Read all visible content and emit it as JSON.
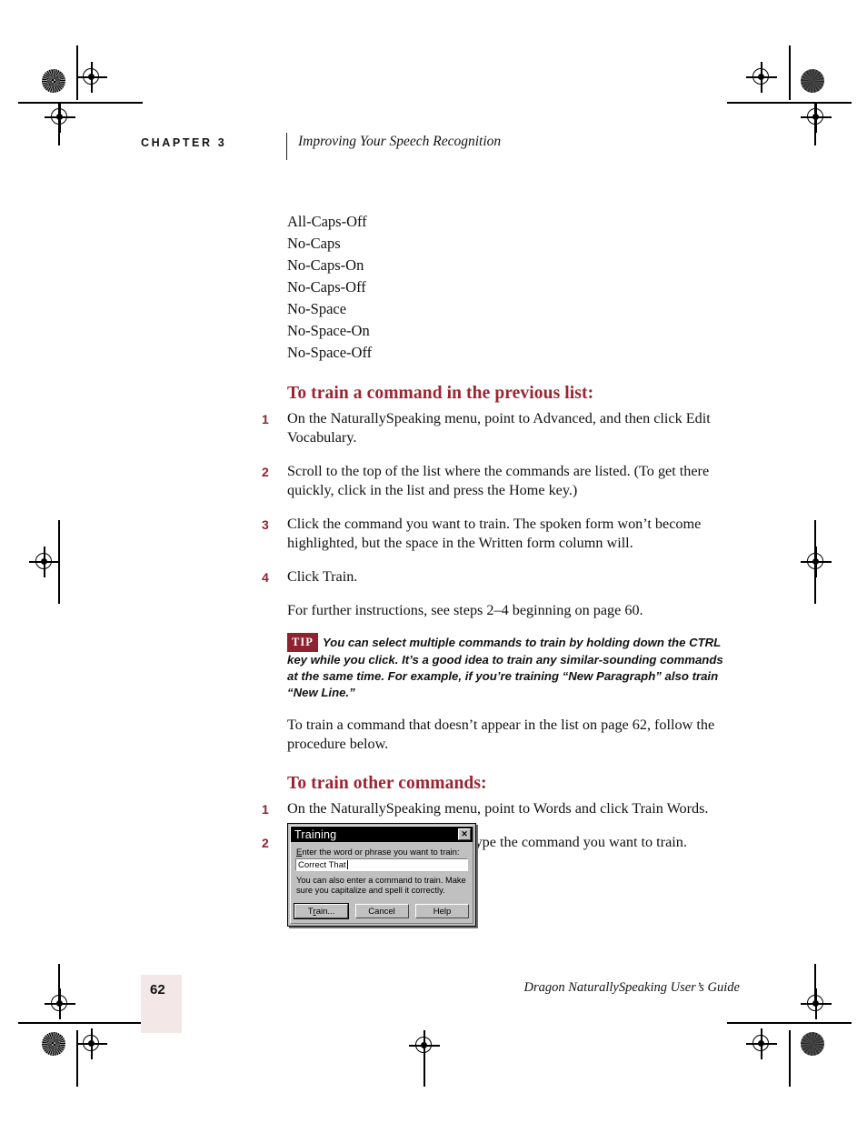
{
  "header": {
    "chapter_label": "CHAPTER 3",
    "chapter_title": "Improving Your Speech Recognition"
  },
  "command_list": [
    "All-Caps-Off",
    "No-Caps",
    "No-Caps-On",
    "No-Caps-Off",
    "No-Space",
    "No-Space-On",
    "No-Space-Off"
  ],
  "section_one": {
    "heading": "To train a command in the previous list:",
    "steps": [
      {
        "num": "1",
        "text": "On the NaturallySpeaking menu, point to Advanced, and then click Edit Vocabulary."
      },
      {
        "num": "2",
        "text": "Scroll to the top of the list where the commands are listed. (To get there quickly, click in the list and press the Home key.)"
      },
      {
        "num": "3",
        "text": "Click the command you want to train. The spoken form won’t become highlighted, but the space in the Written form column will."
      },
      {
        "num": "4",
        "text": "Click Train."
      }
    ],
    "follow_up": "For further instructions, see steps 2–4 beginning on page 60."
  },
  "tip": {
    "badge": "TIP",
    "text": "You can select multiple commands to train by holding down the CTRL key while you click. It’s a good idea to train any similar-sounding commands at the same time. For example, if you’re training “New Paragraph” also train “New Line.”"
  },
  "intro_paragraph": "To train a command that doesn’t appear in the list on page 62, follow the procedure below.",
  "section_two": {
    "heading": "To train other commands:",
    "steps": [
      {
        "num": "1",
        "text": "On the NaturallySpeaking menu, point to Words and click Train Words."
      },
      {
        "num": "2",
        "text": "In the Train Words dialog box, type the command you want to train."
      }
    ]
  },
  "dialog": {
    "title": "Training",
    "close_glyph": "✕",
    "field_label_accel": "E",
    "field_label_rest": "nter the word or phrase you want to train:",
    "input_value": "Correct That",
    "note": "You can also enter a command to train.  Make sure you capitalize and spell it correctly.",
    "buttons": [
      {
        "accel_pre": "T",
        "accel": "r",
        "accel_post": "ain...",
        "label": "Train...",
        "default": true
      },
      {
        "label": "Cancel",
        "default": false
      },
      {
        "label": "Help",
        "default": false
      }
    ]
  },
  "footer": {
    "page_number": "62",
    "guide_title": "Dragon NaturallySpeaking User’s Guide"
  },
  "colors": {
    "heading_maroon": "#9b2430",
    "tip_badge": "#8e2230",
    "step_number": "#8e2230",
    "page_box": "#f3e8e7",
    "dialog_face": "#c0c0c0",
    "titlebar": "#000000"
  }
}
